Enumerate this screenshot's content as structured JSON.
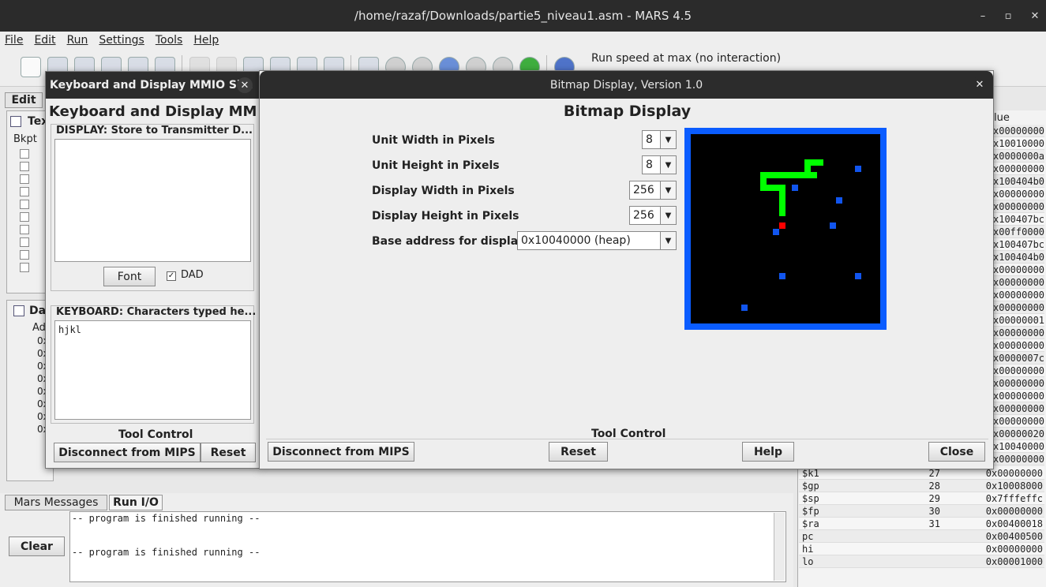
{
  "window": {
    "title": "/home/razaf/Downloads/partie5_niveau1.asm  - MARS 4.5",
    "minimize": "–",
    "maximize": "▫",
    "close": "✕"
  },
  "menu": [
    "File",
    "Edit",
    "Run",
    "Settings",
    "Tools",
    "Help"
  ],
  "toolbar": {
    "run_speed": "Run speed at max (no interaction)"
  },
  "main_tabs": {
    "edit": "Edit"
  },
  "text_segment": {
    "title": "Tex",
    "bkpt_header": "Bkpt"
  },
  "data_segment": {
    "title": "Dat",
    "addr_header": "Ad",
    "rows": [
      "0x",
      "0x",
      "0x",
      "0x",
      "0x",
      "0x",
      "0x",
      "0x"
    ]
  },
  "mmio": {
    "title": "Keyboard and Display MMIO Si...",
    "heading": "Keyboard and Display MM",
    "display_label": "DISPLAY: Store to Transmitter D...",
    "font_button": "Font",
    "dad_checkbox": "DAD",
    "dad_checked": true,
    "keyboard_label": "KEYBOARD: Characters typed he...",
    "keyboard_text": "hjkl",
    "tool_control": "Tool Control",
    "disconnect": "Disconnect from MIPS",
    "reset": "Reset"
  },
  "bitmap": {
    "title": "Bitmap Display, Version 1.0",
    "heading": "Bitmap Display",
    "unit_width_label": "Unit Width in Pixels",
    "unit_width": "8",
    "unit_height_label": "Unit Height in Pixels",
    "unit_height": "8",
    "display_width_label": "Display Width in Pixels",
    "display_width": "256",
    "display_height_label": "Display Height in Pixels",
    "display_height": "256",
    "base_address_label": "Base address for display",
    "base_address": "0x10040000 (heap)",
    "tool_control": "Tool Control",
    "disconnect": "Disconnect from MIPS",
    "reset": "Reset",
    "help": "Help",
    "close": "Close",
    "canvas_colors": {
      "border": "#0a5cff",
      "background": "#000000",
      "snake": "#00ff00",
      "food": "#ff0000",
      "obstacle": "#1155ee"
    }
  },
  "registers": {
    "header": "lue",
    "values_top": [
      "x00000000",
      "x10010000",
      "x0000000a",
      "x00000000",
      "x100404b0",
      "x00000000",
      "x00000000",
      "x100407bc",
      "x00ff0000",
      "x100407bc",
      "x100404b0",
      "x00000000",
      "x00000000",
      "x00000000",
      "x00000000",
      "x00000001",
      "x00000000",
      "x00000000",
      "x0000007c",
      "x00000000",
      "x00000000",
      "x00000000",
      "x00000000",
      "x00000000",
      "x00000020",
      "x10040000",
      "x00000000"
    ],
    "rows": [
      {
        "name": "$k1",
        "num": "27",
        "value": "0x00000000"
      },
      {
        "name": "$gp",
        "num": "28",
        "value": "0x10008000"
      },
      {
        "name": "$sp",
        "num": "29",
        "value": "0x7fffeffc"
      },
      {
        "name": "$fp",
        "num": "30",
        "value": "0x00000000"
      },
      {
        "name": "$ra",
        "num": "31",
        "value": "0x00400018"
      },
      {
        "name": "pc",
        "num": "",
        "value": "0x00400500"
      },
      {
        "name": "hi",
        "num": "",
        "value": "0x00000000"
      },
      {
        "name": "lo",
        "num": "",
        "value": "0x00001000"
      }
    ]
  },
  "messages": {
    "tab_messages": "Mars Messages",
    "tab_runio": "Run I/O",
    "clear": "Clear",
    "line1": "-- program is finished running --",
    "line2": "-- program is finished running --"
  }
}
